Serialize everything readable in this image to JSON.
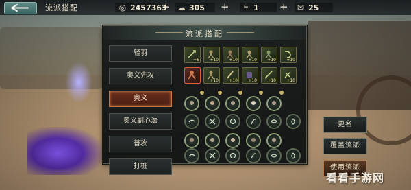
{
  "header": {
    "title": "流派搭配",
    "coins": "2457363",
    "currency2": "305",
    "energy": "1",
    "tickets": "25"
  },
  "panel": {
    "title": "流派搭配",
    "tabs": [
      {
        "label": "轻羽",
        "active": false
      },
      {
        "label": "奥义先攻",
        "active": false
      },
      {
        "label": "奥义",
        "active": true
      },
      {
        "label": "奥义副心法",
        "active": false
      },
      {
        "label": "普攻",
        "active": false
      },
      {
        "label": "打桩",
        "active": false
      }
    ],
    "items_row1": [
      "+6",
      "+10",
      "+10",
      "+10",
      "+10",
      "+10"
    ],
    "items_row2": [
      "",
      "+10",
      "+10",
      "+10",
      "+10",
      "+10"
    ]
  },
  "side_buttons": {
    "rename": "更名",
    "overwrite": "覆盖流派",
    "use": "使用流派"
  },
  "watermark": "看看手游网",
  "colors": {
    "accent": "#c0763e",
    "panel_bg": "#161a19",
    "gold_text": "#e9e2c8"
  }
}
